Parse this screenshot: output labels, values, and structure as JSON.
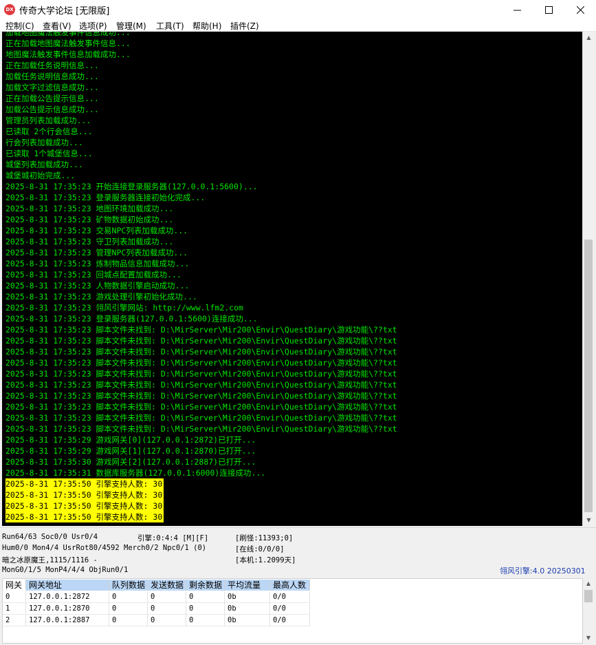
{
  "window": {
    "icon_text": "DX",
    "title": "传奇大学论坛 [无限版]"
  },
  "menu": [
    "控制(C)",
    "查看(V)",
    "选项(P)",
    "管理(M)",
    "工具(T)",
    "帮助(H)",
    "插件(Z)"
  ],
  "log": [
    {
      "text": "加载地图魔法触发事件信息成功...",
      "hl": false
    },
    {
      "text": "正在加载地图魔法触发事件信息...",
      "hl": false
    },
    {
      "text": "地图魔法触发事件信息加载成功...",
      "hl": false
    },
    {
      "text": "正在加载任务说明信息...",
      "hl": false
    },
    {
      "text": "加载任务说明信息成功...",
      "hl": false
    },
    {
      "text": "加载文字过滤信息成功...",
      "hl": false
    },
    {
      "text": "正在加载公告提示信息...",
      "hl": false
    },
    {
      "text": "加载公告提示信息成功...",
      "hl": false
    },
    {
      "text": "管理员列表加载成功...",
      "hl": false
    },
    {
      "text": "已读取 2个行会信息...",
      "hl": false
    },
    {
      "text": "行会列表加载成功...",
      "hl": false
    },
    {
      "text": "已读取 1个城堡信息...",
      "hl": false
    },
    {
      "text": "城堡列表加载成功...",
      "hl": false
    },
    {
      "text": "城堡城初始完成...",
      "hl": false
    },
    {
      "text": "2025-8-31 17:35:23 开始连接登录服务器(127.0.0.1:5600)...",
      "hl": false
    },
    {
      "text": "2025-8-31 17:35:23 登录服务器连接初始化完成...",
      "hl": false
    },
    {
      "text": "2025-8-31 17:35:23 地图环境加载成功...",
      "hl": false
    },
    {
      "text": "2025-8-31 17:35:23 矿物数据初始成功...",
      "hl": false
    },
    {
      "text": "2025-8-31 17:35:23 交易NPC列表加载成功...",
      "hl": false
    },
    {
      "text": "2025-8-31 17:35:23 守卫列表加载成功...",
      "hl": false
    },
    {
      "text": "2025-8-31 17:35:23 管理NPC列表加载成功...",
      "hl": false
    },
    {
      "text": "2025-8-31 17:35:23 炼制物品信息加载成功...",
      "hl": false
    },
    {
      "text": "2025-8-31 17:35:23 回城点配置加载成功...",
      "hl": false
    },
    {
      "text": "2025-8-31 17:35:23 人物数据引擎启动成功...",
      "hl": false
    },
    {
      "text": "2025-8-31 17:35:23 游戏处理引擎初始化成功...",
      "hl": false
    },
    {
      "text": "2025-8-31 17:35:23 翎风引擎网站: http://www.lfm2.com",
      "hl": false
    },
    {
      "text": "2025-8-31 17:35:23 登录服务器(127.0.0.1:5600)连接成功...",
      "hl": false
    },
    {
      "text": "2025-8-31 17:35:23 脚本文件未找到: D:\\MirServer\\Mir200\\Envir\\QuestDiary\\游戏功能\\??txt",
      "hl": false
    },
    {
      "text": "2025-8-31 17:35:23 脚本文件未找到: D:\\MirServer\\Mir200\\Envir\\QuestDiary\\游戏功能\\??txt",
      "hl": false
    },
    {
      "text": "2025-8-31 17:35:23 脚本文件未找到: D:\\MirServer\\Mir200\\Envir\\QuestDiary\\游戏功能\\??txt",
      "hl": false
    },
    {
      "text": "2025-8-31 17:35:23 脚本文件未找到: D:\\MirServer\\Mir200\\Envir\\QuestDiary\\游戏功能\\??txt",
      "hl": false
    },
    {
      "text": "2025-8-31 17:35:23 脚本文件未找到: D:\\MirServer\\Mir200\\Envir\\QuestDiary\\游戏功能\\??txt",
      "hl": false
    },
    {
      "text": "2025-8-31 17:35:23 脚本文件未找到: D:\\MirServer\\Mir200\\Envir\\QuestDiary\\游戏功能\\??txt",
      "hl": false
    },
    {
      "text": "2025-8-31 17:35:23 脚本文件未找到: D:\\MirServer\\Mir200\\Envir\\QuestDiary\\游戏功能\\??txt",
      "hl": false
    },
    {
      "text": "2025-8-31 17:35:23 脚本文件未找到: D:\\MirServer\\Mir200\\Envir\\QuestDiary\\游戏功能\\??txt",
      "hl": false
    },
    {
      "text": "2025-8-31 17:35:23 脚本文件未找到: D:\\MirServer\\Mir200\\Envir\\QuestDiary\\游戏功能\\??txt",
      "hl": false
    },
    {
      "text": "2025-8-31 17:35:23 脚本文件未找到: D:\\MirServer\\Mir200\\Envir\\QuestDiary\\游戏功能\\??txt",
      "hl": false
    },
    {
      "text": "2025-8-31 17:35:29 游戏网关[0](127.0.0.1:2872)已打开...",
      "hl": false
    },
    {
      "text": "2025-8-31 17:35:29 游戏网关[1](127.0.0.1:2870)已打开...",
      "hl": false
    },
    {
      "text": "2025-8-31 17:35:30 游戏网关[2](127.0.0.1:2887)已打开...",
      "hl": false
    },
    {
      "text": "2025-8-31 17:35:31 数据库服务器(127.0.0.1:6000)连接成功...",
      "hl": false
    },
    {
      "text": "2025-8-31 17:35:50 引擎支持人数: 30",
      "hl": true
    },
    {
      "text": "2025-8-31 17:35:50 引擎支持人数: 30",
      "hl": true
    },
    {
      "text": "2025-8-31 17:35:50 引擎支持人数: 30",
      "hl": true
    },
    {
      "text": "2025-8-31 17:35:50 引擎支持人数: 30",
      "hl": true
    }
  ],
  "status": {
    "run": "Run64/63 Soc0/0 Usr0/4",
    "engine": "引擎:0:4:4 [M][F]",
    "refresh": "[刷怪:11393;0]",
    "hum": "Hum0/0 Mon4/4 UsrRot80/4592 Merch0/2 Npc0/1 (0)",
    "online": "[在线:0/0/0]",
    "boss": "暗之冰原魔王,1115/1116 -",
    "local": "[本机:1.2099天]",
    "mon": "MonG0/1/5 MonP4/4/4 ObjRun0/1",
    "version": "翎风引擎:4.0 20250301"
  },
  "gateways": {
    "headers": [
      "网关",
      "网关地址",
      "队列数据",
      "发送数据",
      "剩余数据",
      "平均流量",
      "最高人数"
    ],
    "rows": [
      [
        "0",
        "127.0.0.1:2872",
        "0",
        "0",
        "0",
        "0b",
        "0/0"
      ],
      [
        "1",
        "127.0.0.1:2870",
        "0",
        "0",
        "0",
        "0b",
        "0/0"
      ],
      [
        "2",
        "127.0.0.1:2887",
        "0",
        "0",
        "0",
        "0b",
        "0/0"
      ]
    ]
  },
  "icons": {
    "minimize": "minimize-icon",
    "maximize": "maximize-icon",
    "close": "close-icon",
    "scroll_up": "scroll-up-arrow-icon",
    "scroll_down": "scroll-down-arrow-icon"
  }
}
